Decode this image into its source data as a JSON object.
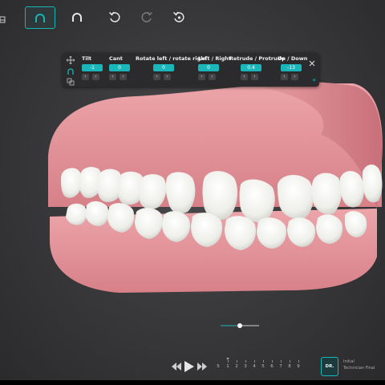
{
  "toolbar": {
    "left_edge_icon": "tray-icon",
    "buttons": [
      {
        "name": "upper-arch-view-button",
        "icon": "arch-icon",
        "active": true
      },
      {
        "name": "lower-arch-view-button",
        "icon": "arch-icon",
        "active": false
      },
      {
        "name": "undo-button",
        "icon": "undo-icon",
        "active": false
      },
      {
        "name": "redo-button",
        "icon": "redo-icon",
        "active": false,
        "disabled": true
      },
      {
        "name": "reset-button",
        "icon": "reset-icon",
        "active": false
      }
    ],
    "accent_color": "#18b3b3"
  },
  "adjust_panel": {
    "controls": [
      {
        "label": "Tilt",
        "value": "-1"
      },
      {
        "label": "Cant",
        "value": "0"
      },
      {
        "label": "Rotate left / rotate right",
        "value": "0"
      },
      {
        "label": "Left / Right",
        "value": "0"
      },
      {
        "label": "Retrude / Protrude",
        "value": "0.4"
      },
      {
        "label": "Up / Down",
        "value": "-13"
      }
    ],
    "stepper_left": "‹",
    "stepper_right": "›",
    "close_label": "✕",
    "collapse_label": "«",
    "side_icons": [
      "move-icon",
      "arch-icon",
      "occlusion-icon"
    ],
    "value_color": "#19b7b9"
  },
  "model": {
    "gum_color": "#e69aa0",
    "tooth_color": "#f4f4f2"
  },
  "bottom": {
    "slider_value": 0.5,
    "playback": [
      "skip-back-icon",
      "play-icon",
      "skip-forward-icon"
    ],
    "stages": [
      "5",
      "1",
      "2",
      "3",
      "4",
      "5",
      "6",
      "7",
      "8",
      "9"
    ],
    "current_stage": "1",
    "dr_label": "DR.",
    "stage_info_line1": "Initial",
    "stage_info_line2": "Technician Final"
  }
}
